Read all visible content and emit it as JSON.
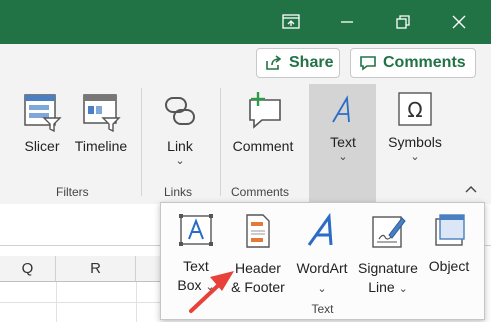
{
  "titlebar": {
    "background": "#217346",
    "buttons": [
      "ribbon-display-options-icon",
      "minimize-icon",
      "restore-icon",
      "close-icon"
    ]
  },
  "ribbon": {
    "share_label": "Share",
    "comments_label": "Comments",
    "accent": "#217346",
    "commands": {
      "slicer": "Slicer",
      "timeline": "Timeline",
      "link": "Link",
      "comment": "Comment",
      "text": "Text",
      "symbols": "Symbols"
    },
    "groups": {
      "filters": "Filters",
      "links": "Links",
      "comments": "Comments"
    }
  },
  "sheet": {
    "columns": [
      "Q",
      "R"
    ]
  },
  "text_menu": {
    "items": [
      {
        "line1": "Text",
        "line2": "Box"
      },
      {
        "line1": "Header",
        "line2": "& Footer"
      },
      {
        "line1": "WordArt",
        "line2": ""
      },
      {
        "line1": "Signature",
        "line2": "Line"
      },
      {
        "line1": "Object",
        "line2": ""
      }
    ],
    "group_label": "Text",
    "arrow_color": "#e8413a"
  }
}
